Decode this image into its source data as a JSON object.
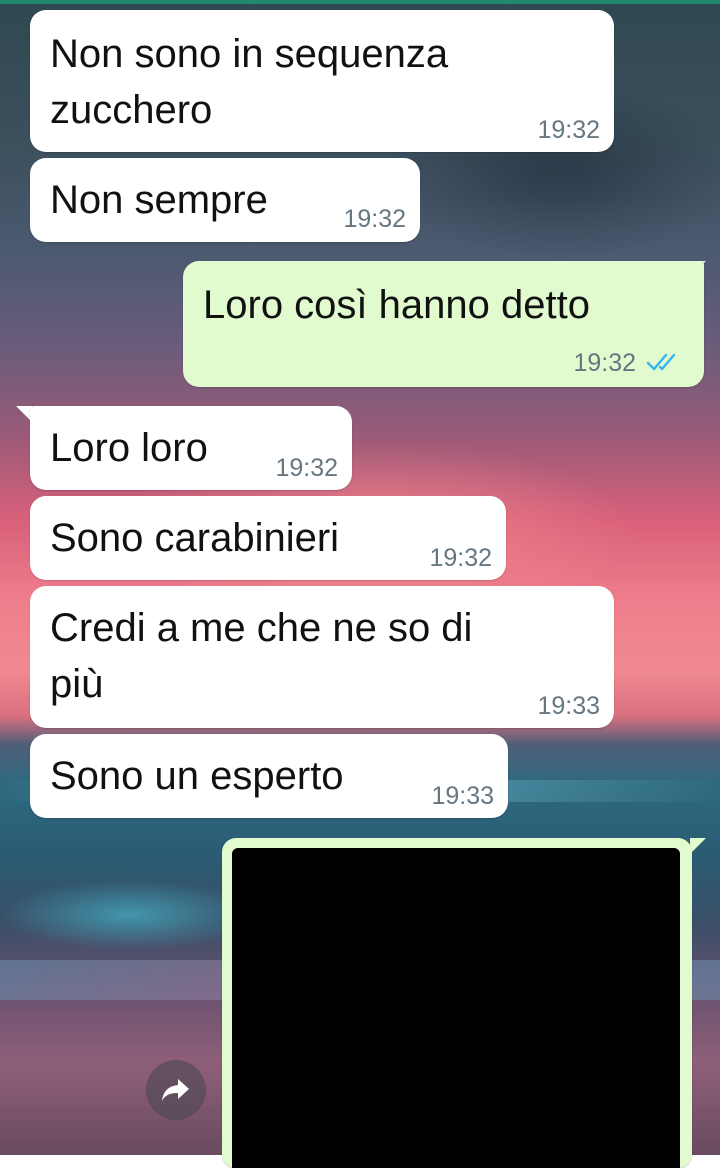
{
  "messages": [
    {
      "dir": "in",
      "text_line1": "Non sono in sequenza",
      "text_line2": "zucchero",
      "time": "19:32"
    },
    {
      "dir": "in",
      "text": "Non sempre",
      "time": "19:32"
    },
    {
      "dir": "out",
      "text": "Loro così hanno detto",
      "time": "19:32",
      "status": "read"
    },
    {
      "dir": "in",
      "text": "Loro loro",
      "time": "19:32"
    },
    {
      "dir": "in",
      "text": "Sono carabinieri",
      "time": "19:32"
    },
    {
      "dir": "in",
      "text_line1": "Credi a me che ne so di",
      "text_line2": "più",
      "time": "19:33"
    },
    {
      "dir": "in",
      "text": "Sono un esperto",
      "time": "19:33"
    }
  ],
  "media_message": {
    "dir": "out",
    "content": "redacted image"
  },
  "colors": {
    "incoming_bubble": "#ffffff",
    "outgoing_bubble": "#e1fbcf",
    "timestamp": "#667781",
    "read_ticks": "#34b7f1"
  },
  "icons": {
    "forward": "forward-arrow-icon",
    "read": "double-check-icon"
  }
}
